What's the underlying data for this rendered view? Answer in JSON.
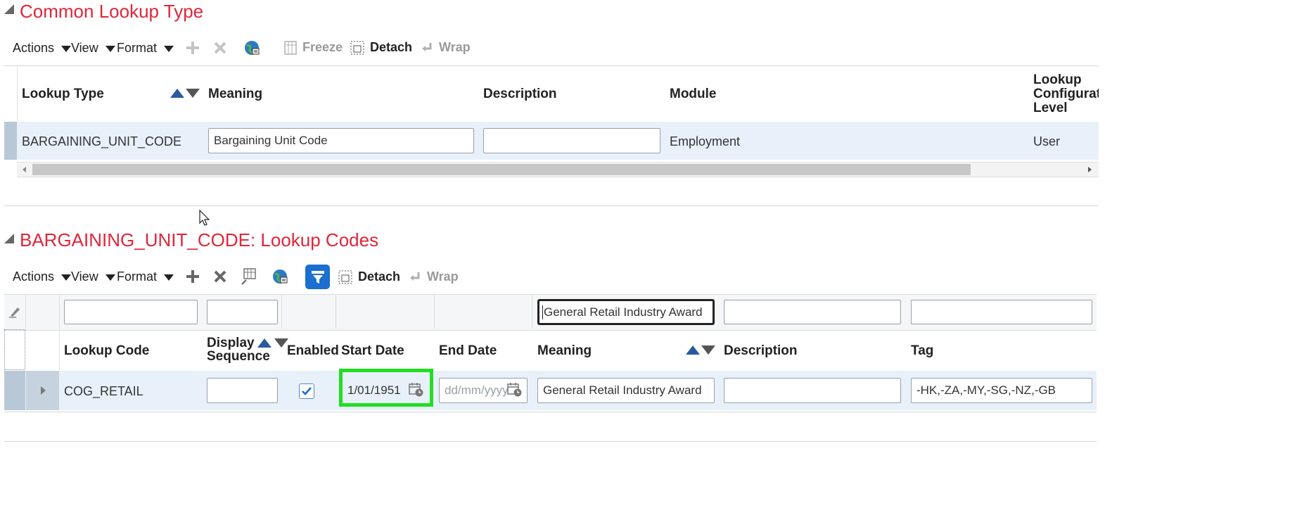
{
  "section1": {
    "title": "Common Lookup Type",
    "toolbar": {
      "actions": "Actions",
      "view": "View",
      "format": "Format",
      "freeze": "Freeze",
      "detach": "Detach",
      "wrap": "Wrap"
    },
    "columns": {
      "lookup_type": "Lookup Type",
      "meaning": "Meaning",
      "description": "Description",
      "module": "Module",
      "config_level_1": "Lookup",
      "config_level_2": "Configuratio",
      "config_level_3": "Level"
    },
    "row": {
      "lookup_type": "BARGAINING_UNIT_CODE",
      "meaning": "Bargaining Unit Code",
      "description": "",
      "module": "Employment",
      "config_level": "User"
    }
  },
  "section2": {
    "title": "BARGAINING_UNIT_CODE: Lookup Codes",
    "toolbar": {
      "actions": "Actions",
      "view": "View",
      "format": "Format",
      "detach": "Detach",
      "wrap": "Wrap"
    },
    "filters": {
      "lookup_code": "",
      "display_sequence": "",
      "meaning": "General Retail Industry Award",
      "description": "",
      "tag": ""
    },
    "columns": {
      "lookup_code": "Lookup Code",
      "display_1": "Display",
      "display_2": "Sequence",
      "enabled": "Enabled",
      "start_date": "Start Date",
      "end_date": "End Date",
      "meaning": "Meaning",
      "description": "Description",
      "tag": "Tag"
    },
    "row": {
      "lookup_code": "COG_RETAIL",
      "display_sequence": "",
      "enabled": true,
      "start_date": "1/01/1951",
      "end_date_placeholder": "dd/mm/yyyy",
      "meaning": "General Retail Industry Award",
      "description": "",
      "tag": "-HK,-ZA,-MY,-SG,-NZ,-GB"
    }
  },
  "colors": {
    "title": "#e0263a",
    "row_highlight": "#e8f1fa",
    "focus_highlight": "#22dd22",
    "accent": "#1a6fcf"
  }
}
